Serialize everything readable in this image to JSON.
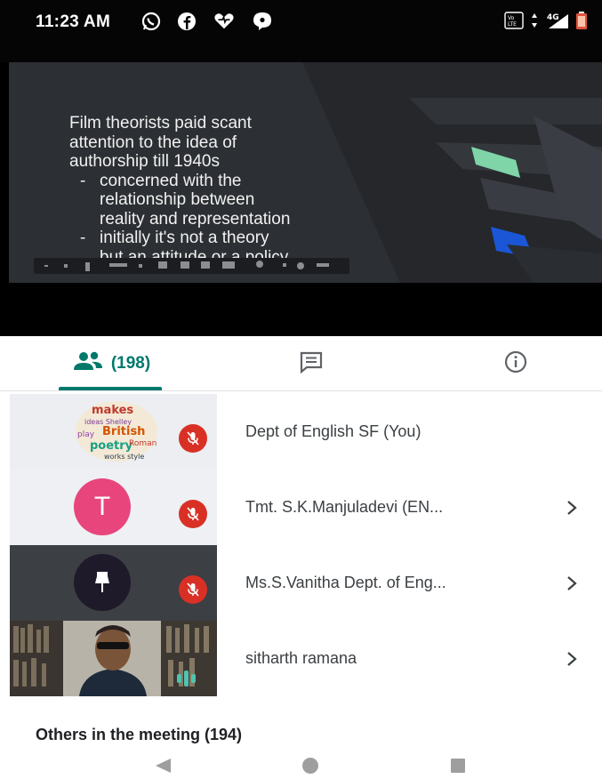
{
  "status_bar": {
    "time": "11:23 AM",
    "app_icons": [
      "whatsapp-icon",
      "facebook-icon",
      "heart-chat-icon",
      "messenger-icon"
    ],
    "network": "4G"
  },
  "slide": {
    "lines": [
      "Film theorists paid scant",
      "attention to the idea of",
      "authorship till 1940s"
    ],
    "bullets": [
      {
        "dash": "-",
        "lines": [
          "concerned with the",
          "relationship between",
          "reality and representation"
        ]
      },
      {
        "dash": "-",
        "lines": [
          "initially it's not a theory",
          "but an attitude or a policy"
        ]
      }
    ]
  },
  "tabs": {
    "people_count": "(198)",
    "people_icon": "people-icon",
    "chat_icon": "chat-icon",
    "info_icon": "info-icon",
    "accent_color": "#00796b"
  },
  "participants": [
    {
      "name": "Dept of English SF (You)",
      "avatar": "word-cloud",
      "muted": true,
      "chevron": false
    },
    {
      "name": "Tmt. S.K.Manjuladevi (EN...",
      "avatar": "letter",
      "initial": "T",
      "avatar_color": "#e8457d",
      "muted": true,
      "chevron": true
    },
    {
      "name": "Ms.S.Vanitha Dept. of Eng...",
      "avatar": "pin",
      "avatar_color": "#1f1a29",
      "muted": true,
      "chevron": true
    },
    {
      "name": "sitharth ramana",
      "avatar": "video",
      "muted": false,
      "chevron": true
    }
  ],
  "others_label": "Others in the meeting (194)",
  "mute_color": "#d93025"
}
